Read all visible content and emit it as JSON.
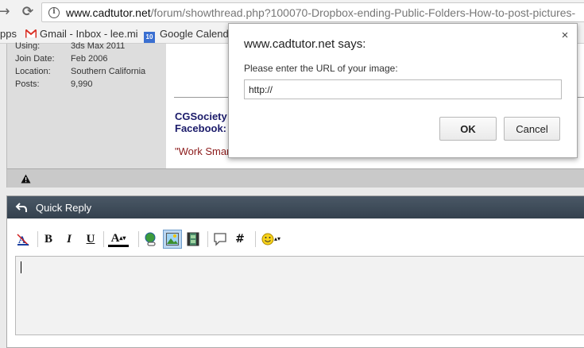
{
  "browser": {
    "back_glyph": "←",
    "forward_glyph": "→",
    "reload_glyph": "C",
    "url_host": "www.cadtutor.net",
    "url_path": "/forum/showthread.php?100070-Dropbox-ending-Public-Folders-How-to-post-pictures-"
  },
  "bookmarks": {
    "apps": "pps",
    "gmail": "Gmail - Inbox - lee.mi",
    "calendar_badge": "10",
    "calendar": "Google Calenda"
  },
  "userinfo": [
    {
      "key": "Using:",
      "value": "3ds Max 2011"
    },
    {
      "key": "Join Date:",
      "value": "Feb 2006"
    },
    {
      "key": "Location:",
      "value": "Southern California"
    },
    {
      "key": "Posts:",
      "value": "9,990"
    }
  ],
  "signature": {
    "line1": "CGSociety",
    "line2": "Facebook:",
    "line3": "\"Work Smar"
  },
  "quick_reply": {
    "title": "Quick Reply"
  },
  "toolbar": {
    "bold": "B",
    "italic": "I",
    "underline": "U",
    "font_color": "A",
    "hash": "#"
  },
  "dialog": {
    "title": "www.cadtutor.net says:",
    "message": "Please enter the URL of your image:",
    "input_value": "http://",
    "ok_label": "OK",
    "cancel_label": "Cancel",
    "close": "×"
  },
  "colors": {
    "header_bg": "#3d4a57",
    "sig_link": "#1b1b6a",
    "sig_quote": "#8b1a1a"
  }
}
